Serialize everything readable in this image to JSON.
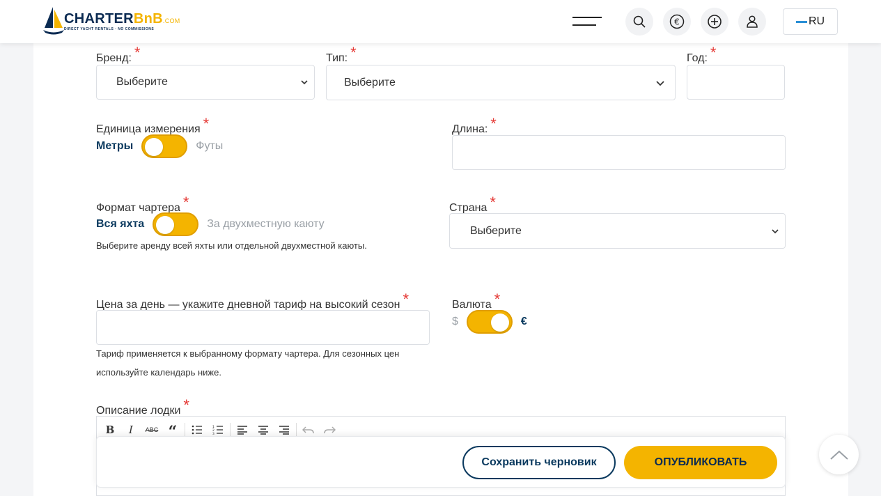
{
  "header": {
    "logo": {
      "text_main": "CHARTER",
      "text_accent": "BnB",
      "text_com": ".COM",
      "tagline": "DIRECT YACHT RENTALS · NO COMMISSIONS"
    },
    "language": "RU",
    "icons": [
      "menu-icon",
      "search-icon",
      "euro-icon",
      "add-icon",
      "user-icon"
    ]
  },
  "form": {
    "brand": {
      "label": "Бренд:",
      "value": "Выберите"
    },
    "type": {
      "label": "Тип:",
      "value": "Выберите"
    },
    "year": {
      "label": "Год:",
      "value": ""
    },
    "unit": {
      "label": "Единица измерения",
      "option_on": "Метры",
      "option_off": "Футы"
    },
    "length": {
      "label": "Длина:",
      "value": ""
    },
    "charter_format": {
      "label": "Формат чартера",
      "option_on": "Вся яхта",
      "option_off": "За двухместную каюту",
      "hint": "Выберите аренду всей яхты или отдельной двухместной каюты."
    },
    "country": {
      "label": "Страна",
      "value": "Выберите"
    },
    "price": {
      "label": "Цена за день — укажите дневной тариф на высокий сезон",
      "value": "",
      "hint": "Тариф применяется к выбранному формату чартера. Для сезонных цен используйте календарь ниже."
    },
    "currency": {
      "label": "Валюта",
      "option_off": "$",
      "option_on": "€"
    },
    "description": {
      "label": "Описание лодки"
    },
    "required_mark": "*"
  },
  "actions": {
    "save_draft": "Сохранить черновик",
    "publish": "ОПУБЛИКОВАТЬ"
  },
  "colors": {
    "accent": "#f4b400",
    "navy": "#0b3a5f",
    "required": "#e53935"
  }
}
